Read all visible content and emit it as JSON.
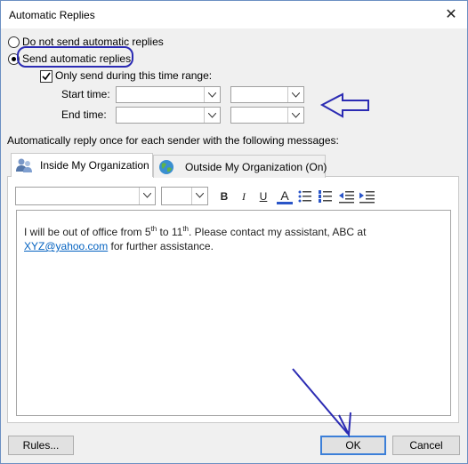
{
  "window": {
    "title": "Automatic Replies",
    "close_glyph": "✕"
  },
  "options": {
    "dont_send": "Do not send automatic replies",
    "send": "Send automatic replies",
    "only_send_range": "Only send during this time range:",
    "start_time_label": "Start time:",
    "end_time_label": "End time:"
  },
  "instruction": "Automatically reply once for each sender with the following messages:",
  "tabs": [
    {
      "label": "Inside My Organization",
      "active": true
    },
    {
      "label": "Outside My Organization (On)",
      "active": false
    }
  ],
  "toolbar": {
    "bold": "B",
    "italic": "I",
    "underline": "U",
    "font_color": "A"
  },
  "message": {
    "line1_pre": "I will be out of office from 5",
    "sup1": "th",
    "line1_mid": " to 11",
    "sup2": "th",
    "line1_post": ". Please contact my assistant, ABC at",
    "email": "XYZ@yahoo.com",
    "line2_post": " for further assistance."
  },
  "buttons": {
    "rules": "Rules...",
    "ok": "OK",
    "cancel": "Cancel"
  },
  "colors": {
    "annotation": "#2b2bb3",
    "link": "#0563c1",
    "focus": "#3c7fd8"
  }
}
